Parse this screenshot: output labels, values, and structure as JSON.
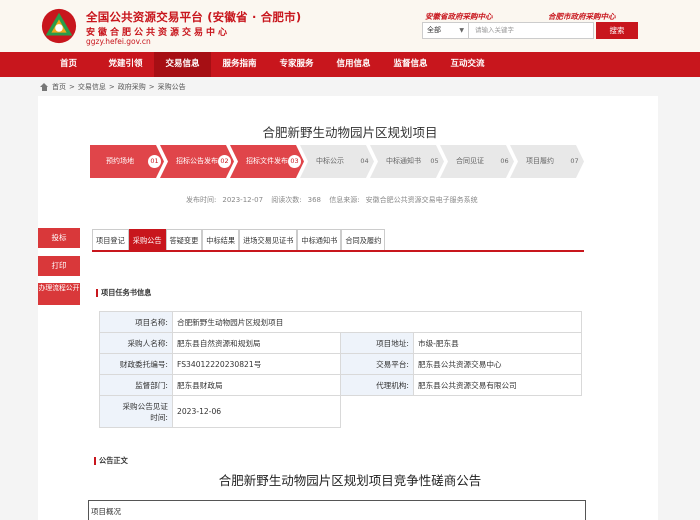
{
  "header": {
    "title": "全国公共资源交易平台 (安徽省 · 合肥市)",
    "subtitle": "安徽合肥公共资源交易中心",
    "url": "ggzy.hefei.gov.cn",
    "quick_links": [
      "安徽省政府采购中心",
      "合肥市政府采购中心"
    ],
    "search": {
      "scope": "全部",
      "placeholder": "请输入关键字",
      "button": "搜索"
    },
    "brand_color": "#c8161d"
  },
  "nav": {
    "items": [
      "首页",
      "党建引领",
      "交易信息",
      "服务指南",
      "专家服务",
      "信用信息",
      "监督信息",
      "互动交流"
    ],
    "active": "交易信息"
  },
  "breadcrumb": [
    "首页",
    "交易信息",
    "政府采购",
    "采购公告"
  ],
  "project": {
    "title": "合肥新野生动物园片区规划项目",
    "steps": [
      {
        "label": "预约场地",
        "num": "01",
        "state": "done"
      },
      {
        "label": "招标公告发布",
        "num": "02",
        "state": "done"
      },
      {
        "label": "招标文件发布",
        "num": "03",
        "state": "done"
      },
      {
        "label": "中标公示",
        "num": "04",
        "state": "todo"
      },
      {
        "label": "中标通知书",
        "num": "05",
        "state": "todo"
      },
      {
        "label": "合同见证",
        "num": "06",
        "state": "todo"
      },
      {
        "label": "项目履约",
        "num": "07",
        "state": "todo"
      }
    ],
    "meta": {
      "publish_label": "发布时间:",
      "publish_time": "2023-12-07",
      "views_label": "阅读次数:",
      "views": "368",
      "source_label": "信息来源:",
      "source": "安徽合肥公共资源交易电子服务系统"
    }
  },
  "side_buttons": [
    "投标",
    "打印",
    "办理流程公开"
  ],
  "tabs": [
    "项目登记",
    "采购公告",
    "答疑变更",
    "中标结果",
    "进场交易见证书",
    "中标通知书",
    "合同及履约"
  ],
  "active_tab": "采购公告",
  "task_section": {
    "label": "项目任务书信息",
    "rows": {
      "project_name_k": "项目名称:",
      "project_name_v": "合肥新野生动物园片区规划项目",
      "buyer_k": "采购人名称:",
      "buyer_v": "肥东县自然资源和规划局",
      "address_k": "项目地址:",
      "address_v": "市级-肥东县",
      "code_k": "财政委托编号:",
      "code_v": "FS34012220230821号",
      "platform_k": "交易平台:",
      "platform_v": "肥东县公共资源交易中心",
      "dept_k": "监督部门:",
      "dept_v": "肥东县财政局",
      "agent_k": "代理机构:",
      "agent_v": "肥东县公共资源交易有限公司",
      "witness_k1": "采购公告见证",
      "witness_k2": "时间:",
      "witness_v": "2023-12-06"
    }
  },
  "notice": {
    "section_label": "公告正文",
    "title": "合肥新野生动物园片区规划项目竞争性磋商公告",
    "overview": "项目概况"
  }
}
